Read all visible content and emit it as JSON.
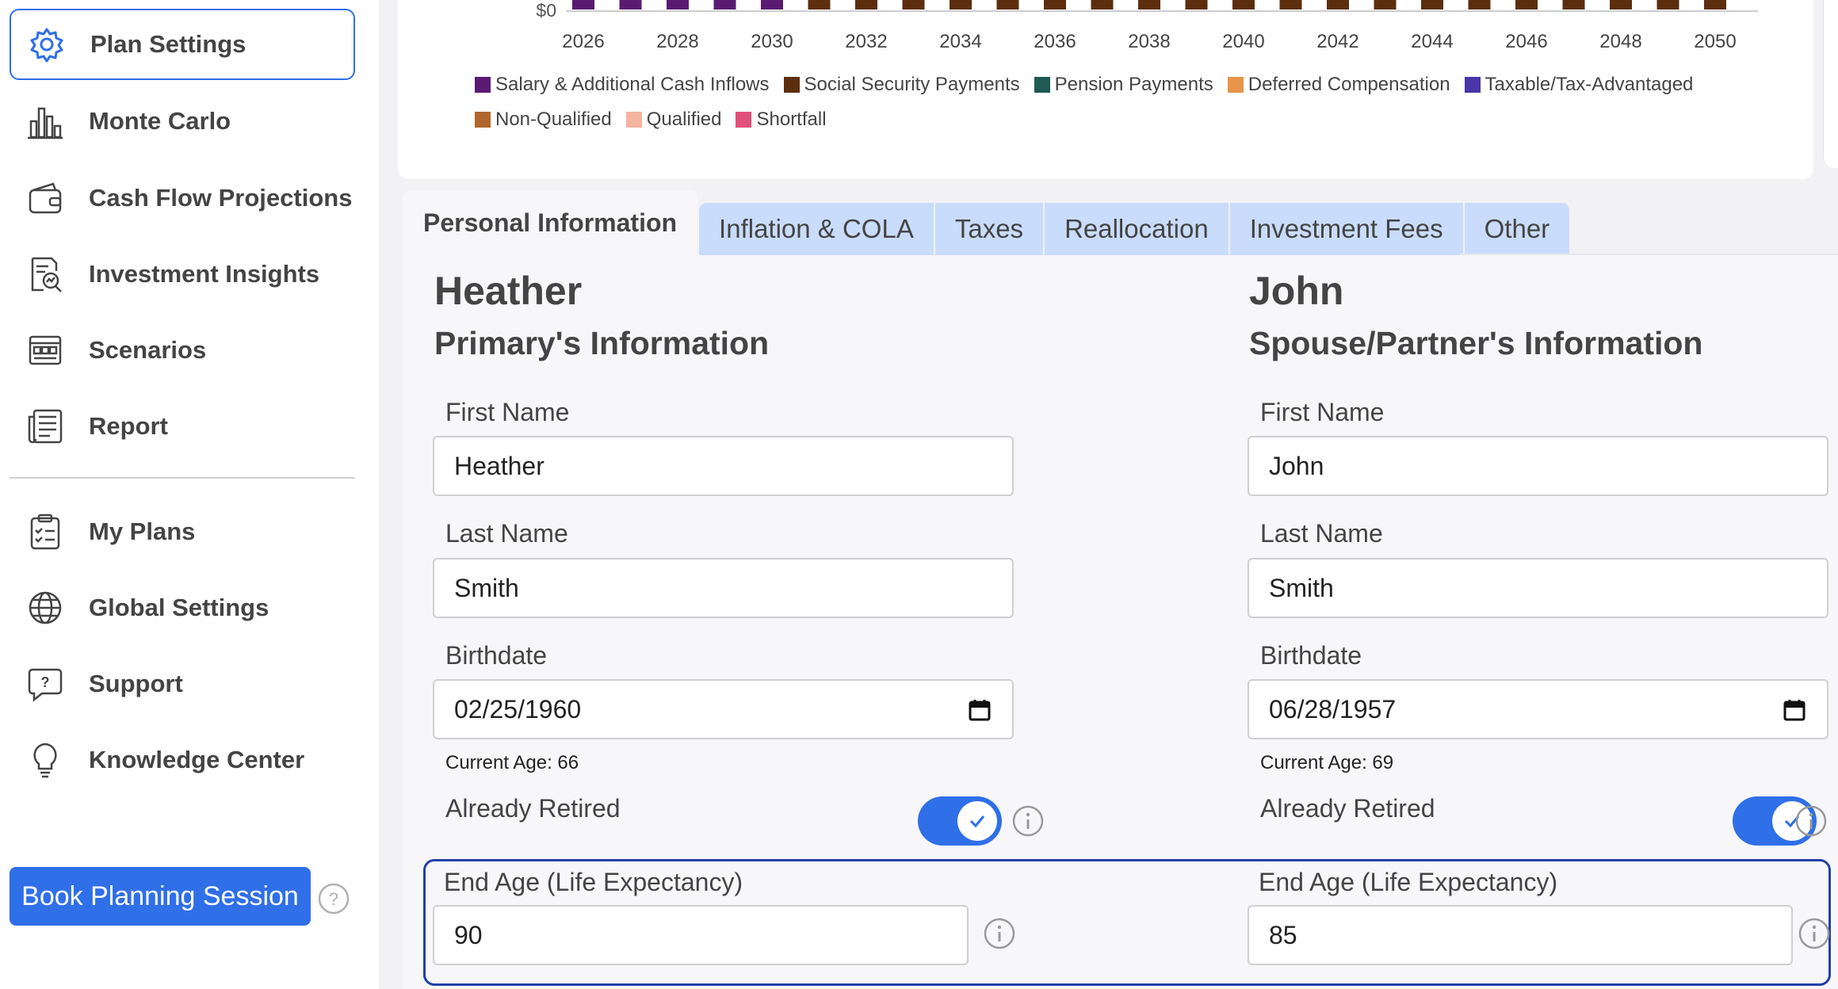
{
  "sidebar": {
    "items": [
      {
        "label": "Plan Settings",
        "icon": "gear-icon",
        "active": true
      },
      {
        "label": "Monte Carlo",
        "icon": "bar-chart-icon"
      },
      {
        "label": "Cash Flow Projections",
        "icon": "wallet-icon"
      },
      {
        "label": "Investment Insights",
        "icon": "insights-icon"
      },
      {
        "label": "Scenarios",
        "icon": "scenarios-icon"
      },
      {
        "label": "Report",
        "icon": "report-icon"
      }
    ],
    "secondary": [
      {
        "label": "My Plans",
        "icon": "clipboard-icon"
      },
      {
        "label": "Global Settings",
        "icon": "globe-icon"
      },
      {
        "label": "Support",
        "icon": "support-chat-icon"
      },
      {
        "label": "Knowledge Center",
        "icon": "lightbulb-icon"
      }
    ],
    "book_button": "Book Planning Session",
    "help_icon": "question-icon"
  },
  "chart_data": {
    "type": "bar",
    "y_tick_visible": "$0",
    "x_ticks": [
      "2026",
      "2028",
      "2030",
      "2032",
      "2034",
      "2036",
      "2038",
      "2040",
      "2042",
      "2044",
      "2046",
      "2048",
      "2050"
    ],
    "bar_years": [
      2026,
      2027,
      2028,
      2029,
      2030,
      2031,
      2032,
      2033,
      2034,
      2035,
      2036,
      2037,
      2038,
      2039,
      2040,
      2041,
      2042,
      2043,
      2044,
      2045,
      2046,
      2047,
      2048,
      2049,
      2050
    ],
    "bar_colors_by_year": [
      "#5a1a72",
      "#5a1a72",
      "#5a1a72",
      "#5a1a72",
      "#5a1a72",
      "#5c2e0e",
      "#5c2e0e",
      "#5c2e0e",
      "#5c2e0e",
      "#5c2e0e",
      "#5c2e0e",
      "#5c2e0e",
      "#5c2e0e",
      "#5c2e0e",
      "#5c2e0e",
      "#5c2e0e",
      "#5c2e0e",
      "#5c2e0e",
      "#5c2e0e",
      "#5c2e0e",
      "#5c2e0e",
      "#5c2e0e",
      "#5c2e0e",
      "#5c2e0e",
      "#5c2e0e"
    ],
    "legend": [
      {
        "name": "Salary & Additional Cash Inflows",
        "color": "#5a1a72"
      },
      {
        "name": "Social Security Payments",
        "color": "#5c2e0e"
      },
      {
        "name": "Pension Payments",
        "color": "#1f5a54"
      },
      {
        "name": "Deferred Compensation",
        "color": "#e8944a"
      },
      {
        "name": "Taxable/Tax-Advantaged",
        "color": "#4a36a8"
      },
      {
        "name": "Non-Qualified",
        "color": "#b0662e"
      },
      {
        "name": "Qualified",
        "color": "#f4b4a0"
      },
      {
        "name": "Shortfall",
        "color": "#e0507a"
      }
    ]
  },
  "tabs": [
    {
      "label": "Personal Information",
      "active": true
    },
    {
      "label": "Inflation & COLA"
    },
    {
      "label": "Taxes"
    },
    {
      "label": "Reallocation"
    },
    {
      "label": "Investment Fees"
    },
    {
      "label": "Other"
    }
  ],
  "primary": {
    "name": "Heather",
    "subtitle": "Primary's Information",
    "first_name_label": "First Name",
    "first_name": "Heather",
    "last_name_label": "Last Name",
    "last_name": "Smith",
    "birthdate_label": "Birthdate",
    "birthdate": "02/25/1960",
    "current_age": "Current Age: 66",
    "retired_label": "Already Retired",
    "retired": true,
    "end_age_label": "End Age (Life Expectancy)",
    "end_age": "90"
  },
  "spouse": {
    "name": "John",
    "subtitle": "Spouse/Partner's Information",
    "first_name_label": "First Name",
    "first_name": "John",
    "last_name_label": "Last Name",
    "last_name": "Smith",
    "birthdate_label": "Birthdate",
    "birthdate": "06/28/1957",
    "current_age": "Current Age: 69",
    "retired_label": "Already Retired",
    "retired": true,
    "end_age_label": "End Age (Life Expectancy)",
    "end_age": "85"
  },
  "colors": {
    "accent": "#2f6fe8",
    "tab_inactive": "#c9dcfb",
    "end_age_border": "#2040a8"
  }
}
